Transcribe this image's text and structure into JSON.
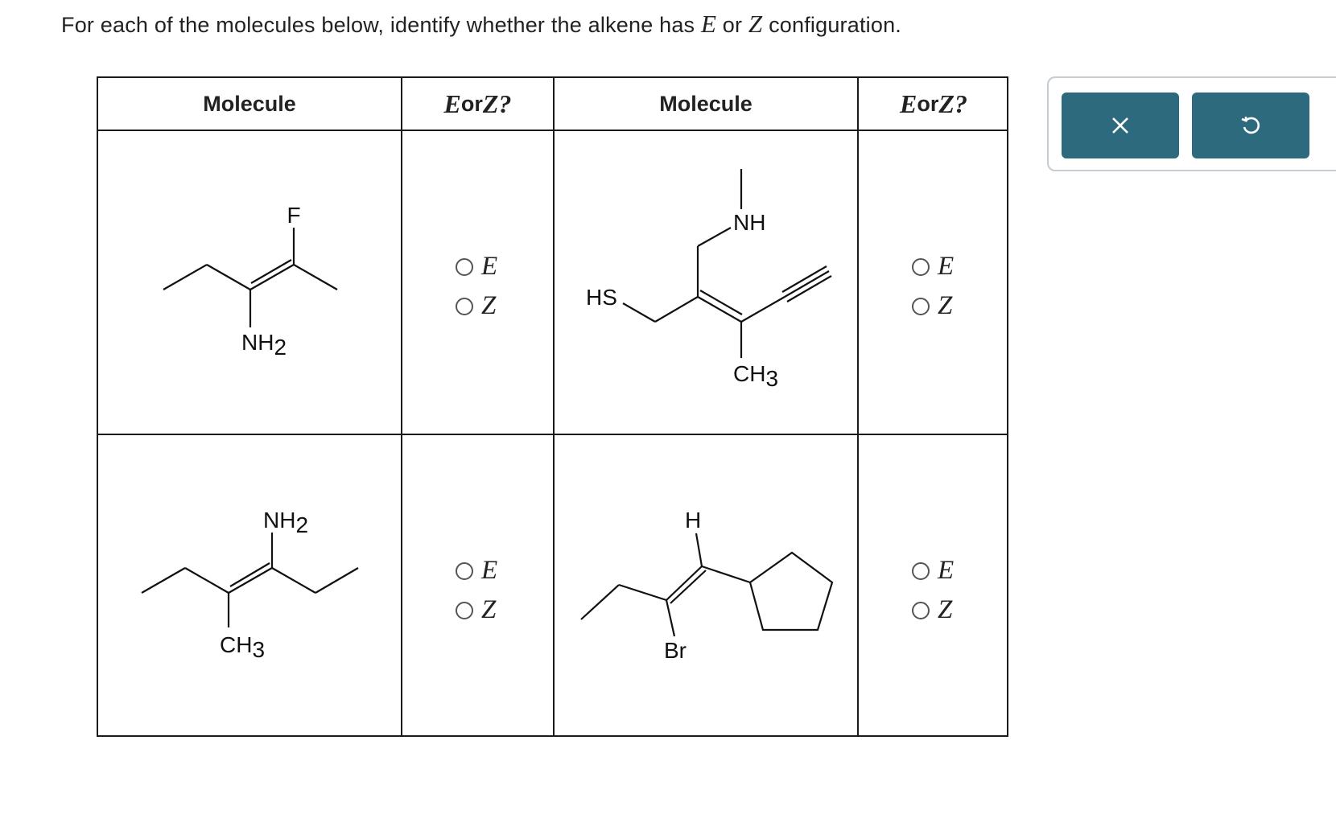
{
  "prompt": {
    "before": "For each of the molecules below, identify whether the alkene has ",
    "e": "E",
    "or": " or ",
    "z": "Z",
    "after": " configuration."
  },
  "table": {
    "col_molecule": "Molecule",
    "col_eorz_e": "E",
    "col_eorz_or": " or ",
    "col_eorz_z": "Z?",
    "option_e": "E",
    "option_z": "Z"
  },
  "molecules": {
    "m1": {
      "top": "F",
      "bottom": "NH",
      "bottom_sub": "2"
    },
    "m2": {
      "top": "NH",
      "left": "HS",
      "bottom": "CH",
      "bottom_sub": "3"
    },
    "m3": {
      "top": "NH",
      "top_sub": "2",
      "bottom": "CH",
      "bottom_sub": "3"
    },
    "m4": {
      "top": "H",
      "bottom": "Br"
    }
  },
  "toolbar": {
    "close_icon": "x-icon",
    "undo_icon": "undo-icon",
    "accent": "#2e6a7d"
  }
}
